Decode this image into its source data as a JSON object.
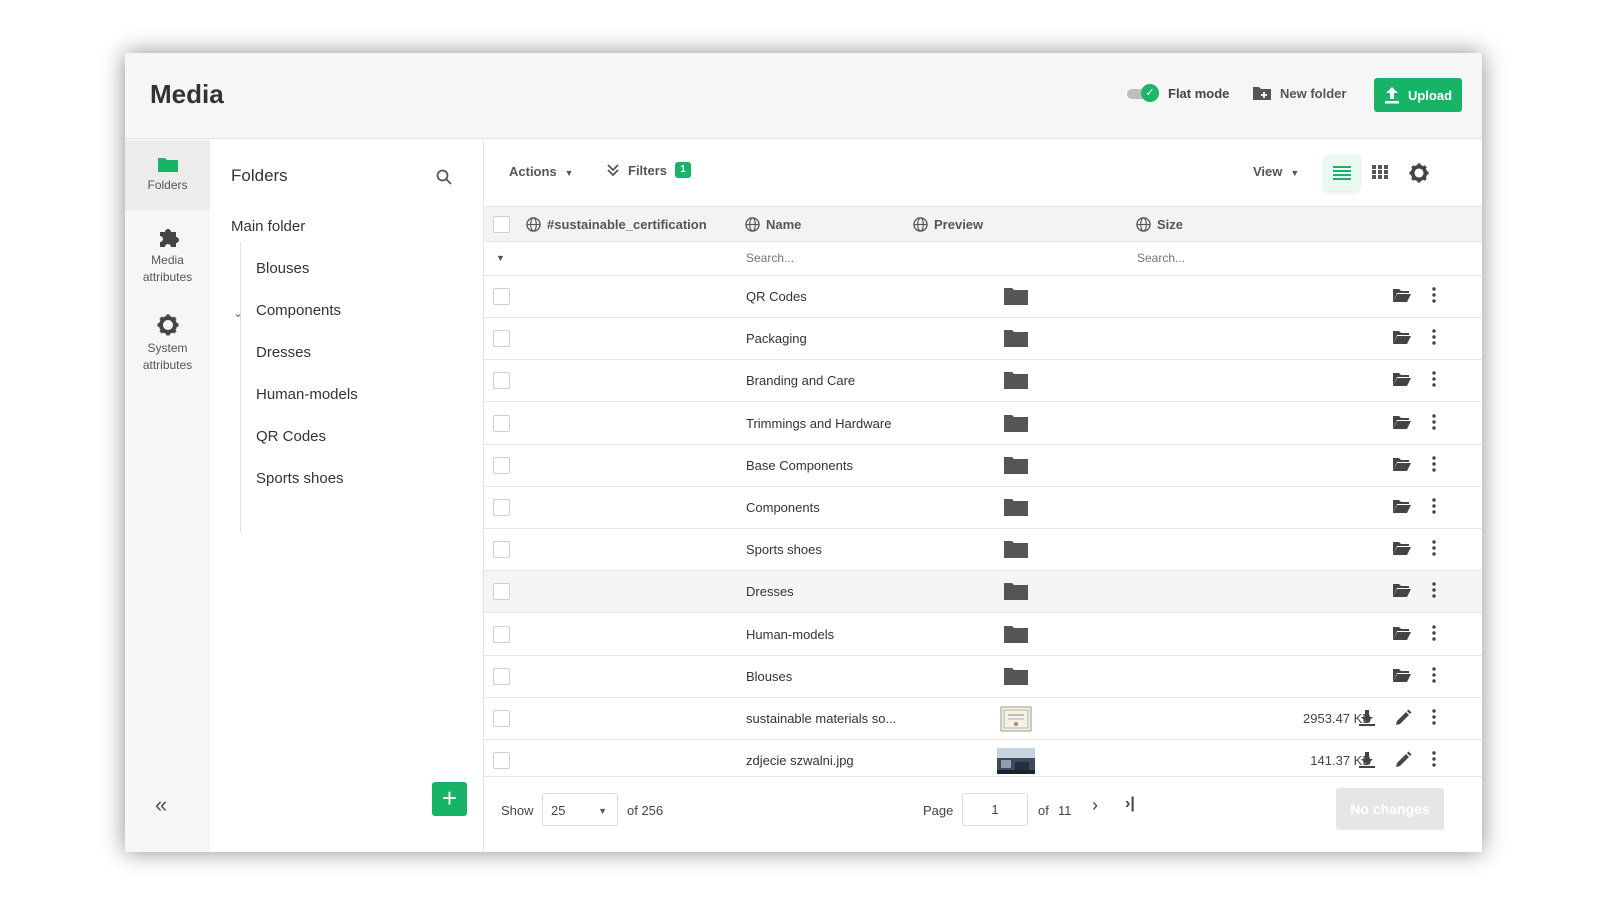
{
  "header": {
    "title": "Media",
    "flat_mode_label": "Flat mode",
    "flat_mode_on": true,
    "new_folder_label": "New folder",
    "upload_label": "Upload",
    "accent_color": "#17b468"
  },
  "leftnav": {
    "items": [
      {
        "label": "Folders",
        "icon": "folder-icon",
        "active": true
      },
      {
        "label": "Media attributes",
        "icon": "puzzle-icon",
        "active": false
      },
      {
        "label": "System attributes",
        "icon": "gear-icon",
        "active": false
      }
    ],
    "collapse_label": "«"
  },
  "folders": {
    "title": "Folders",
    "root": "Main folder",
    "children": [
      "Blouses",
      "Components",
      "Dresses",
      "Human-models",
      "QR Codes",
      "Sports shoes"
    ],
    "expanded": "Components",
    "add_label": "+"
  },
  "toolbar": {
    "actions_label": "Actions",
    "filters_label": "Filters",
    "filters_count": "1",
    "view_label": "View"
  },
  "table": {
    "columns": [
      "#sustainable_certification",
      "Name",
      "Preview",
      "Size"
    ],
    "search_placeholder": "Search...",
    "rows": [
      {
        "name": "QR Codes",
        "type": "folder",
        "size": ""
      },
      {
        "name": "Packaging",
        "type": "folder",
        "size": ""
      },
      {
        "name": "Branding and Care",
        "type": "folder",
        "size": ""
      },
      {
        "name": "Trimmings and Hardware",
        "type": "folder",
        "size": ""
      },
      {
        "name": "Base Components",
        "type": "folder",
        "size": ""
      },
      {
        "name": "Components",
        "type": "folder",
        "size": ""
      },
      {
        "name": "Sports shoes",
        "type": "folder",
        "size": ""
      },
      {
        "name": "Dresses",
        "type": "folder",
        "size": "",
        "highlighted": true
      },
      {
        "name": "Human-models",
        "type": "folder",
        "size": ""
      },
      {
        "name": "Blouses",
        "type": "folder",
        "size": ""
      },
      {
        "name": "sustainable materials so...",
        "type": "file",
        "size": "2953.47  KB"
      },
      {
        "name": "zdjecie szwalni.jpg",
        "type": "file",
        "size": "141.37  KB"
      }
    ]
  },
  "pager": {
    "show_label": "Show",
    "page_size": "25",
    "total_label": "of 256",
    "page_label": "Page",
    "current_page": "1",
    "of_label": "of",
    "total_pages": "11",
    "no_changes_label": "No changes"
  }
}
